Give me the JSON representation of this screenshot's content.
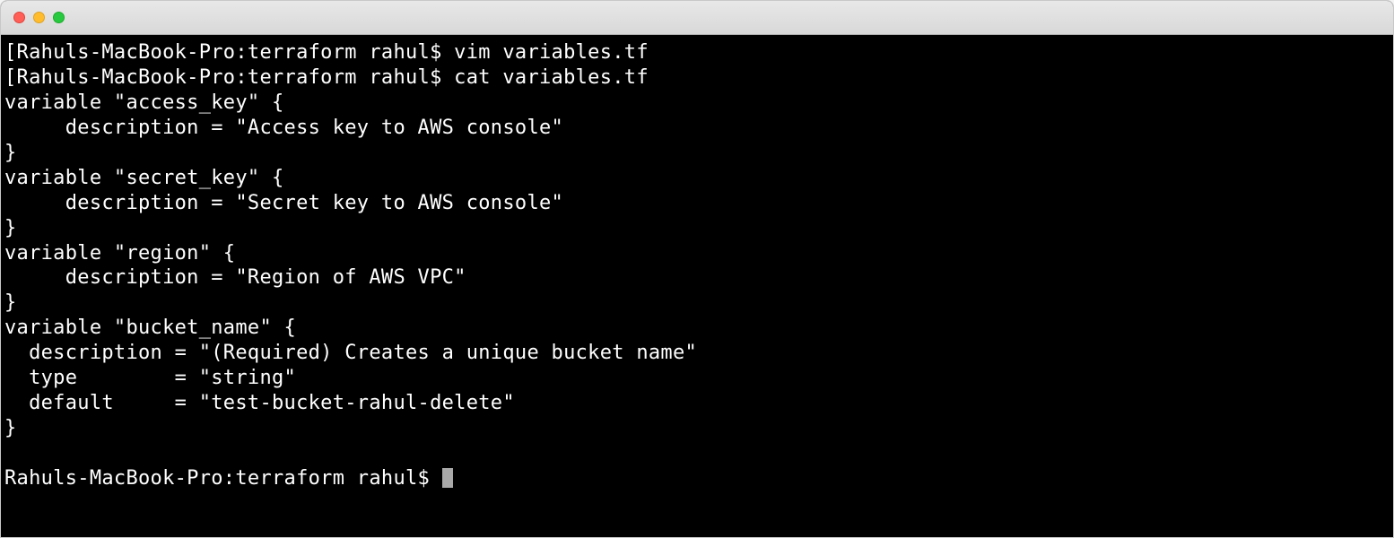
{
  "terminal": {
    "lines": {
      "l0": "[Rahuls-MacBook-Pro:terraform rahul$ vim variables.tf",
      "l1": "[Rahuls-MacBook-Pro:terraform rahul$ cat variables.tf",
      "l2": "variable \"access_key\" {",
      "l3": "     description = \"Access key to AWS console\"",
      "l4": "}",
      "l5": "variable \"secret_key\" {",
      "l6": "     description = \"Secret key to AWS console\"",
      "l7": "}",
      "l8": "variable \"region\" {",
      "l9": "     description = \"Region of AWS VPC\"",
      "l10": "}",
      "l11": "variable \"bucket_name\" {",
      "l12": "  description = \"(Required) Creates a unique bucket name\"",
      "l13": "  type        = \"string\"",
      "l14": "  default     = \"test-bucket-rahul-delete\"",
      "l15": "}",
      "l16": "",
      "l17": "Rahuls-MacBook-Pro:terraform rahul$ "
    }
  }
}
